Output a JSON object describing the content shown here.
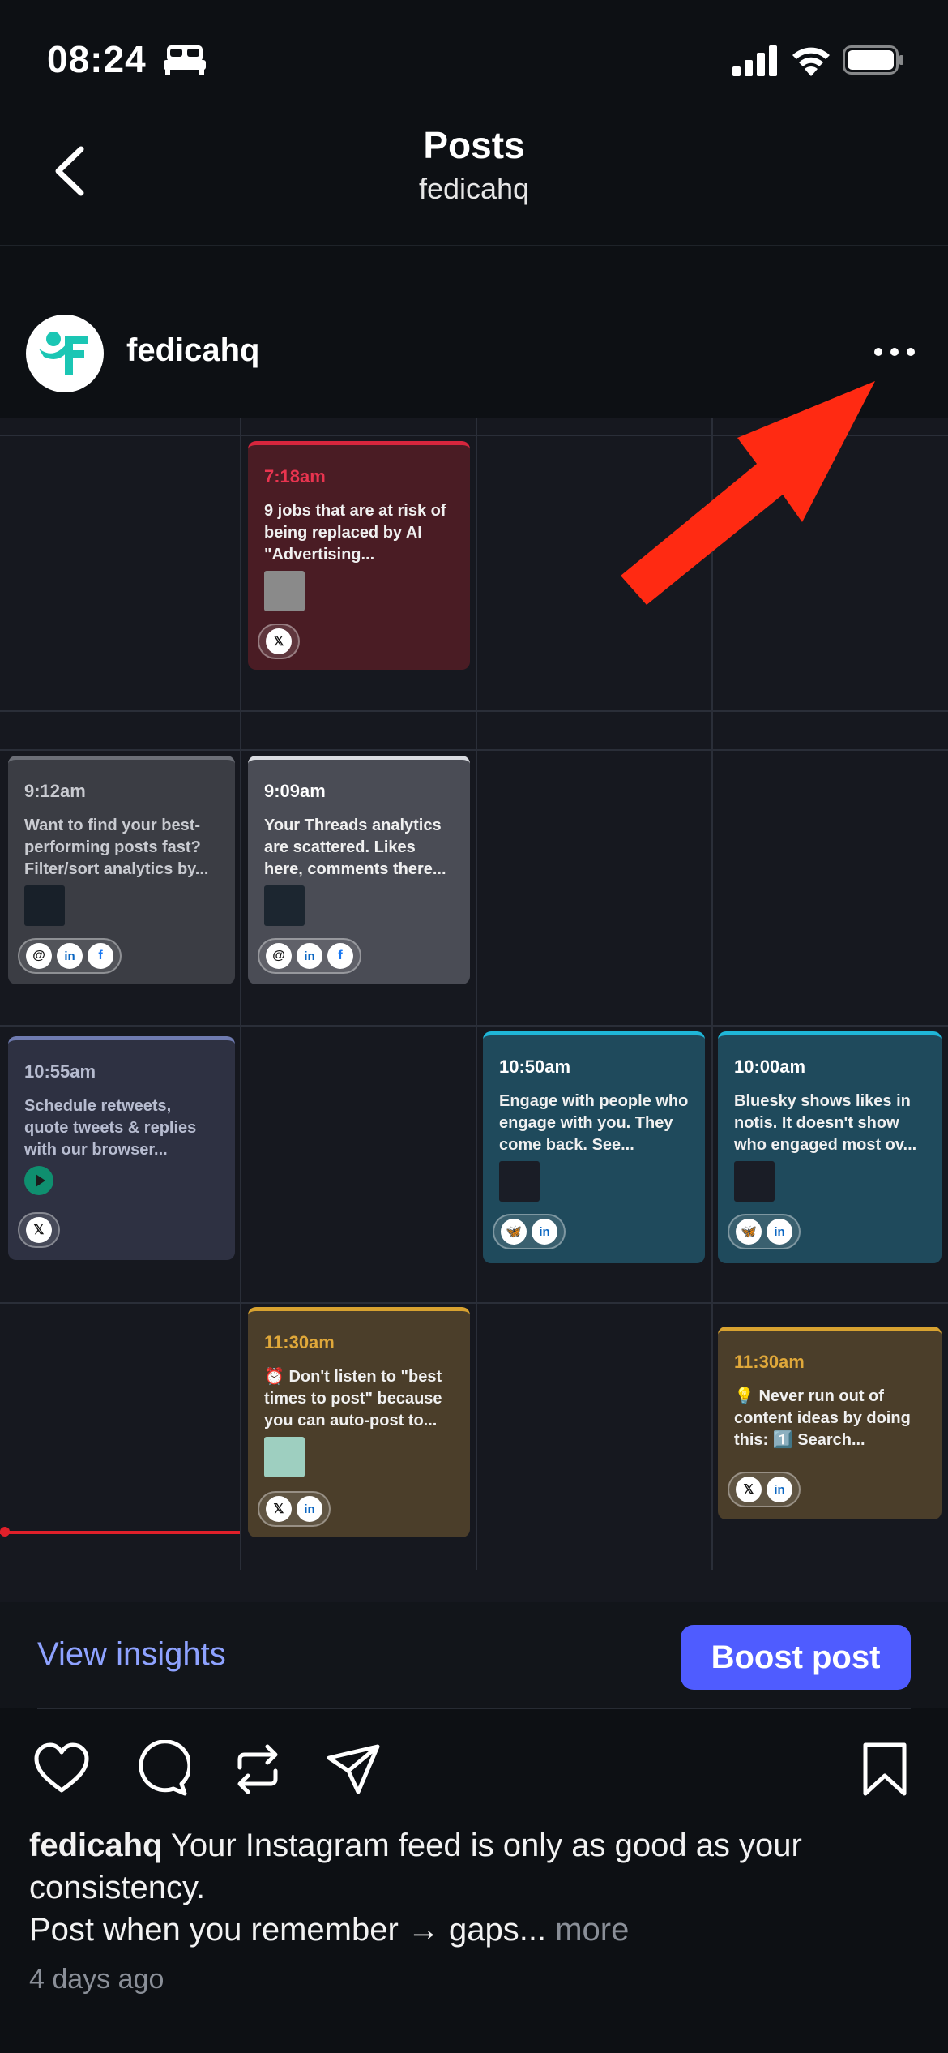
{
  "status_bar": {
    "time": "08:24"
  },
  "header": {
    "title": "Posts",
    "subtitle": "fedicahq"
  },
  "post": {
    "username": "fedicahq",
    "calendar": {
      "cards": [
        {
          "time": "7:18am",
          "text": "9 jobs that are at risk of being replaced by AI \"Advertising...",
          "platforms": [
            "x"
          ]
        },
        {
          "time": "9:12am",
          "text": "Want to find your best-performing posts fast? Filter/sort analytics by...",
          "platforms": [
            "threads",
            "linkedin",
            "facebook"
          ]
        },
        {
          "time": "9:09am",
          "text": "Your Threads analytics are scattered. Likes here, comments there...",
          "platforms": [
            "threads",
            "linkedin",
            "facebook"
          ]
        },
        {
          "time": "10:55am",
          "text": "Schedule retweets, quote tweets & replies with our browser...",
          "platforms": [
            "x"
          ]
        },
        {
          "time": "10:50am",
          "text": "Engage with people who engage with you. They come back. See...",
          "platforms": [
            "bluesky",
            "linkedin"
          ]
        },
        {
          "time": "10:00am",
          "text": "Bluesky shows likes in notis. It doesn't show who engaged most ov...",
          "platforms": [
            "bluesky",
            "linkedin"
          ]
        },
        {
          "time": "11:30am",
          "text": "⏰ Don't listen to \"best times to post\" because you can auto-post to...",
          "platforms": [
            "x",
            "linkedin"
          ]
        },
        {
          "time": "11:30am",
          "text": "💡 Never run out of content ideas by doing this: 1️⃣ Search...",
          "platforms": [
            "x",
            "linkedin"
          ]
        }
      ]
    },
    "view_insights": "View insights",
    "boost_label": "Boost post",
    "caption_user": "fedicahq",
    "caption_line1": " Your Instagram feed is only as good as your consistency.",
    "caption_line2": "Post when you remember → gaps...",
    "caption_more": " more",
    "time_ago": "4 days ago"
  },
  "colors": {
    "accent": "#4f5cff",
    "link": "#8ea2ff",
    "annotation_arrow": "#ff2a12"
  }
}
